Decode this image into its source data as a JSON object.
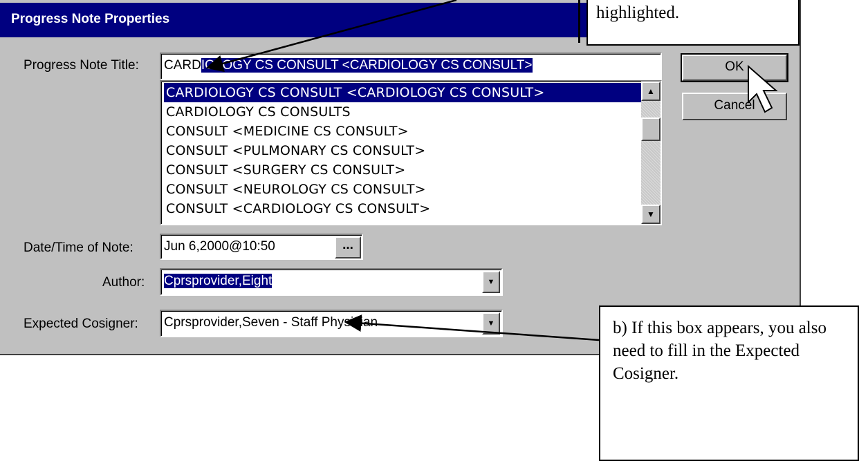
{
  "dialog": {
    "title": "Progress Note Properties",
    "labels": {
      "title": "Progress Note Title:",
      "date": "Date/Time of Note:",
      "author": "Author:",
      "cosigner": "Expected Cosigner:"
    },
    "title_field": {
      "typed": "CARD",
      "autocomplete": "IOLOGY CS CONSULT  <CARDIOLOGY CS CONSULT>"
    },
    "title_list": [
      "CARDIOLOGY CS CONSULT  <CARDIOLOGY CS CONSULT>",
      "CARDIOLOGY CS CONSULTS",
      "CONSULT  <MEDICINE CS CONSULT>",
      "CONSULT  <PULMONARY CS CONSULT>",
      "CONSULT  <SURGERY CS CONSULT>",
      "CONSULT  <NEUROLOGY CS CONSULT>",
      "CONSULT  <CARDIOLOGY CS CONSULT>"
    ],
    "date_value": "Jun 6,2000@10:50",
    "date_button": "...",
    "author_value": "Cprsprovider,Eight",
    "cosigner_value": "Cprsprovider,Seven - Staff Physician",
    "buttons": {
      "ok": "OK",
      "cancel": "Cancel"
    }
  },
  "callouts": {
    "top": "highlighted.",
    "bottom": "b) If this box appears, you also need to fill in the Expected Cosigner."
  },
  "colors": {
    "titlebar": "#000080",
    "dialog_bg": "#c0c0c0",
    "selection": "#000080"
  }
}
